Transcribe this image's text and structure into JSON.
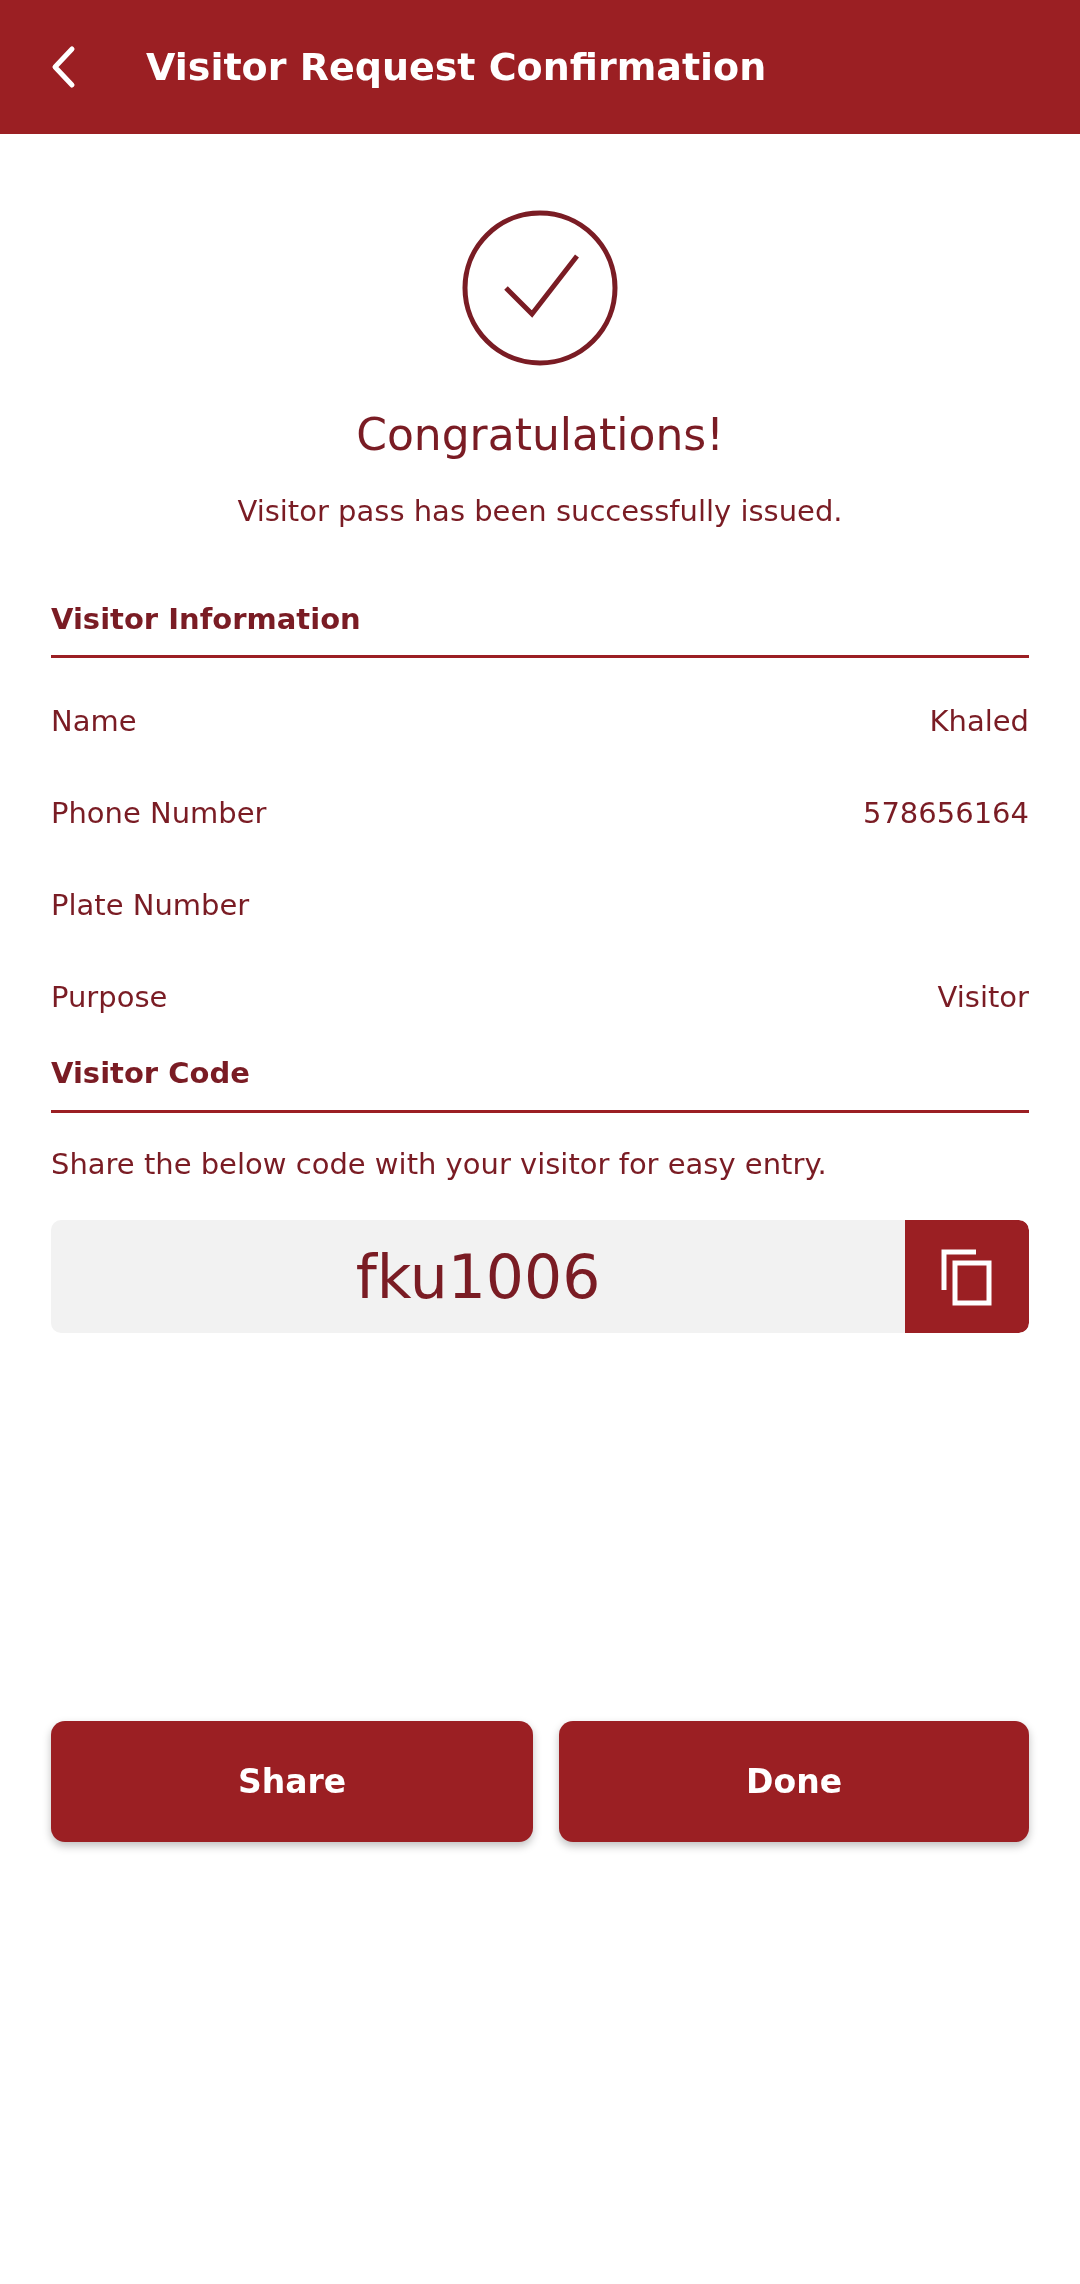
{
  "header": {
    "title": "Visitor Request Confirmation"
  },
  "success": {
    "title": "Congratulations!",
    "message": "Visitor pass has been successfully issued."
  },
  "visitor_information": {
    "heading": "Visitor Information",
    "rows": [
      {
        "label": "Name",
        "value": "Khaled"
      },
      {
        "label": "Phone Number",
        "value": "578656164"
      },
      {
        "label": "Plate Number"
      },
      {
        "label": "Purpose",
        "value": "Visitor"
      }
    ]
  },
  "visitor_code": {
    "heading": "Visitor Code",
    "hint": "Share the below code with your visitor for easy entry.",
    "code": "fku1006"
  },
  "buttons": [
    "Share",
    "Done"
  ]
}
